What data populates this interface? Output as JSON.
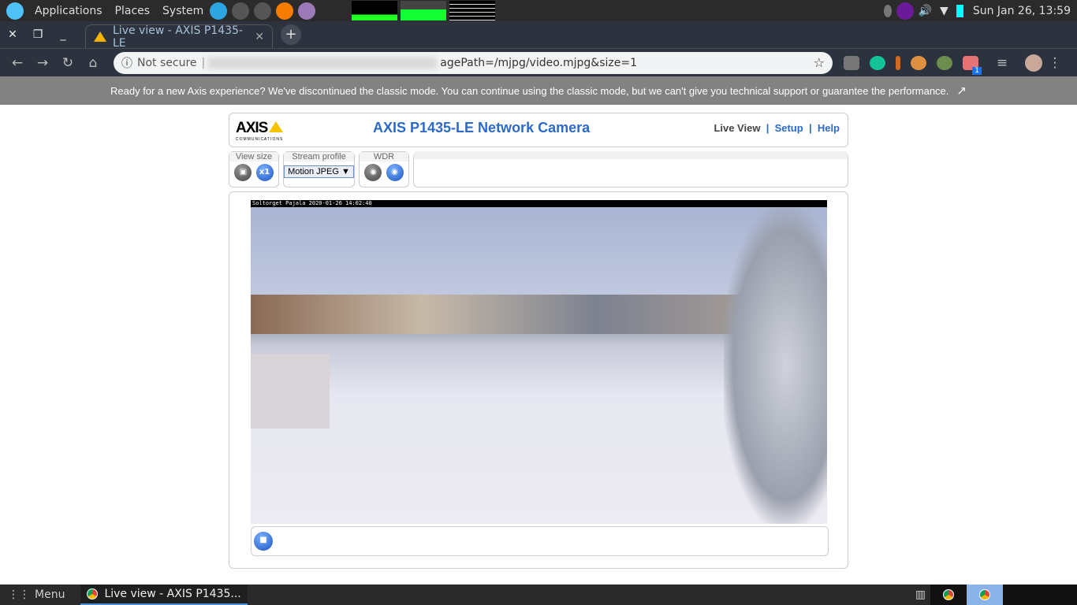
{
  "topbar": {
    "menus": [
      "Applications",
      "Places",
      "System"
    ],
    "clock": "Sun Jan 26, 13:59"
  },
  "browser": {
    "tab_title": "Live view - AXIS P1435-LE",
    "new_tab": "+",
    "security": "Not secure",
    "url_visible": "agePath=/mjpg/video.mjpg&size=1",
    "extension_badge": "1"
  },
  "banner": {
    "text": "Ready for a new Axis experience? We've discontinued the classic mode. You can continue using the classic mode, but we can't give you technical support or guarantee the performance."
  },
  "camera_page": {
    "logo": "AXIS",
    "logo_sub": "COMMUNICATIONS",
    "title": "AXIS P1435-LE Network Camera",
    "nav": [
      "Live View",
      "Setup",
      "Help"
    ],
    "controls": {
      "view_size_label": "View size",
      "view_size_x1": "x1",
      "stream_profile_label": "Stream profile",
      "stream_profile_value": "Motion JPEG",
      "wdr_label": "WDR"
    },
    "overlay_text": "Soltorget Pajala  2020-01-26 14:02:40"
  },
  "taskbar": {
    "menu": "Menu",
    "window": "Live view - AXIS P1435..."
  },
  "colors": {
    "accent": "#2d6ac7",
    "banner": "#828282"
  }
}
